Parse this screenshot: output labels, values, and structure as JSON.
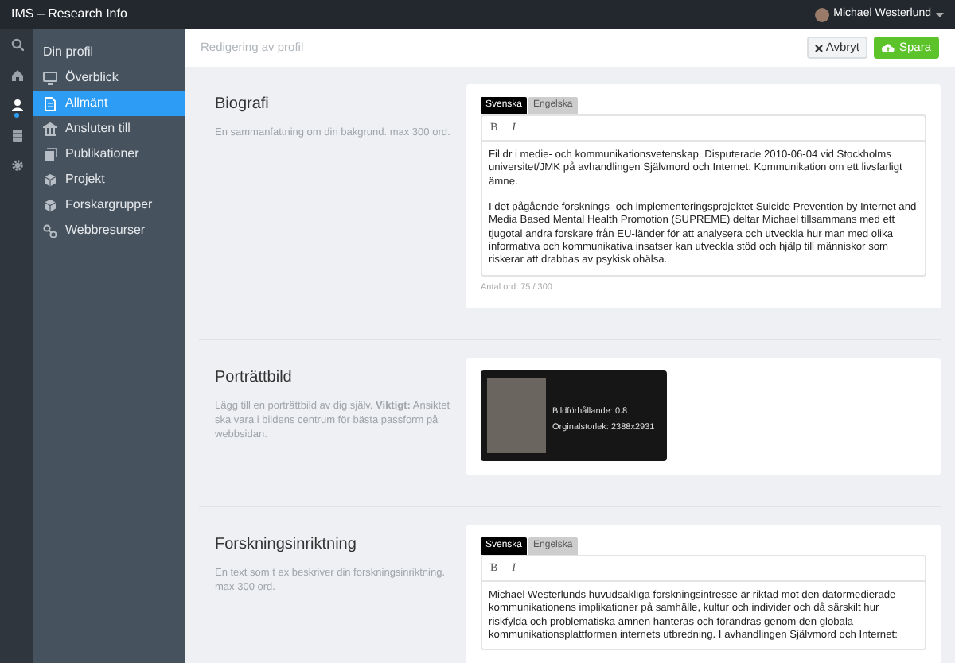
{
  "app_title": "IMS – Research Info",
  "user": {
    "name": "Michael Westerlund"
  },
  "rail": [
    {
      "selected": false
    },
    {
      "selected": false
    },
    {
      "selected": true
    },
    {
      "selected": false
    },
    {
      "selected": false
    }
  ],
  "nav": {
    "heading": "Din profil",
    "items": [
      {
        "label": "Överblick",
        "selected": false
      },
      {
        "label": "Allmänt",
        "selected": true
      },
      {
        "label": "Ansluten till",
        "selected": false
      },
      {
        "label": "Publikationer",
        "selected": false
      },
      {
        "label": "Projekt",
        "selected": false
      },
      {
        "label": "Forskargrupper",
        "selected": false
      },
      {
        "label": "Webbresurser",
        "selected": false
      }
    ]
  },
  "header": {
    "title": "Redigering av profil",
    "buttons": [
      {
        "kind": "cancel",
        "label": "Avbryt"
      },
      {
        "kind": "save",
        "label": "Spara"
      }
    ]
  },
  "sections": [
    {
      "kind": "editor",
      "title": "Biografi",
      "description": "En sammanfattning om din bakgrund. max 300 ord.",
      "tabs": [
        {
          "label": "Svenska",
          "selected": true
        },
        {
          "label": "Engelska",
          "selected": false
        }
      ],
      "toolbar": [
        "B",
        "I"
      ],
      "paragraphs": [
        "Fil dr i medie- och kommunikationsvetenskap. Disputerade 2010-06-04 vid Stockholms universitet/JMK på avhandlingen Självmord och Internet: Kommunikation om ett livsfarligt ämne.",
        "I det pågående forsknings- och implementeringsprojektet Suicide Prevention by Internet and Media Based Mental Health Promotion (SUPREME) deltar Michael tillsammans med ett tjugotal andra forskare från EU-länder för att analysera och utveckla hur man med olika informativa och kommunikativa insatser kan utveckla stöd och hjälp till människor som riskerar att drabbas av psykisk ohälsa."
      ],
      "footer": "Antal ord: 75 / 300"
    },
    {
      "kind": "image",
      "title": "Porträttbild",
      "description": "Lägg till en porträttbild av dig själv. **Viktigt:** Ansiktet ska vara i bildens centrum för bästa passform på webbsidan.",
      "info": [
        "Bildförhållande: 0.8",
        "Orginalstorlek: 2388x2931"
      ]
    },
    {
      "kind": "editor",
      "title": "Forskningsinriktning",
      "description": "En text som t ex beskriver din forskningsinriktning. max 300 ord.",
      "tabs": [
        {
          "label": "Svenska",
          "selected": true
        },
        {
          "label": "Engelska",
          "selected": false
        }
      ],
      "toolbar": [
        "B",
        "I"
      ],
      "paragraphs": [
        "Michael Westerlunds huvudsakliga forskningsintresse är riktad mot den datormedierade kommunikationens implikationer på samhälle, kultur och individer och då särskilt hur riskfylda och problematiska ämnen hanteras och förändras genom den globala kommunikationsplattformen internets utbredning. I avhandlingen Självmord och Internet:"
      ]
    }
  ]
}
